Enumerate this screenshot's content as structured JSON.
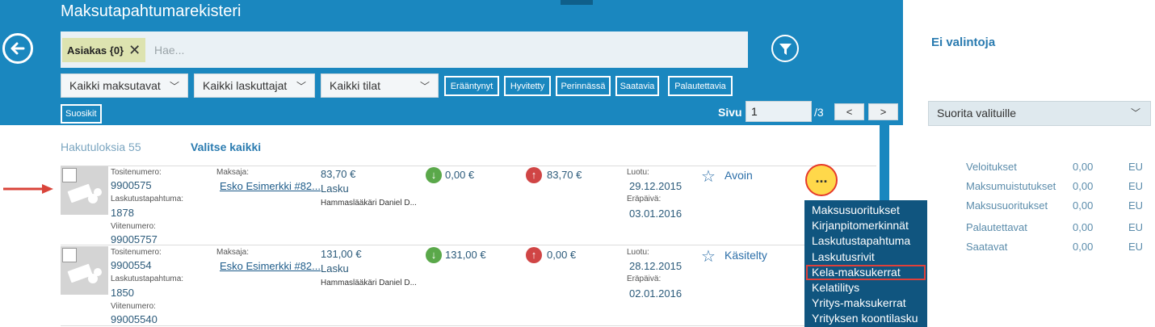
{
  "header": {
    "title": "Maksutapahtumarekisteri",
    "chip_label": "Asiakas {0}",
    "search_placeholder": "Hae...",
    "dropdowns": [
      "Kaikki maksutavat",
      "Kaikki laskuttajat",
      "Kaikki tilat"
    ],
    "filter_buttons": [
      "Erääntynyt",
      "Hyvitetty",
      "Perinnässä",
      "Saatavia",
      "Palautettavia"
    ],
    "favorites_label": "Suosikit",
    "page_label": "Sivu",
    "page_value": "1",
    "page_total": "/3",
    "prev_label": "<",
    "next_label": ">"
  },
  "results": {
    "count_label": "Hakutuloksia 55",
    "select_all_label": "Valitse kaikki",
    "rows": [
      {
        "tosite_label": "Tositenumero:",
        "tosite": "9900575",
        "laskutus_label": "Laskutustapahtuma:",
        "laskutus": "1878",
        "viite_label": "Viitenumero:",
        "viite": "99005757",
        "maksaja_label": "Maksaja:",
        "maksaja": "Esko Esimerkki #82...",
        "amount": "83,70 €",
        "type": "Lasku",
        "provider": "Hammaslääkäri Daniel D...",
        "paid": "0,00 €",
        "open": "83,70 €",
        "luotu_label": "Luotu:",
        "luotu": "29.12.2015",
        "erapaiva_label": "Eräpäivä:",
        "erapaiva": "03.01.2016",
        "status": "Avoin"
      },
      {
        "tosite_label": "Tositenumero:",
        "tosite": "9900554",
        "laskutus_label": "Laskutustapahtuma:",
        "laskutus": "1850",
        "viite_label": "Viitenumero:",
        "viite": "99005540",
        "maksaja_label": "Maksaja:",
        "maksaja": "Esko Esimerkki #82...",
        "amount": "131,00 €",
        "type": "Lasku",
        "provider": "Hammaslääkäri Daniel D...",
        "paid": "131,00 €",
        "open": "0,00 €",
        "luotu_label": "Luotu:",
        "luotu": "28.12.2015",
        "erapaiva_label": "Eräpäivä:",
        "erapaiva": "02.01.2016",
        "status": "Käsitelty"
      }
    ],
    "more_label": "..."
  },
  "menu": {
    "items": [
      "Maksusuoritukset",
      "Kirjanpitomerkinnät",
      "Laskutustapahtuma",
      "Laskutusrivit",
      "Kela-maksukerrat",
      "Kelatilitys",
      "Yritys-maksukerrat",
      "Yrityksen koontilasku"
    ],
    "highlighted": "Kela-maksukerrat"
  },
  "right_panel": {
    "title": "Ei valintoja",
    "action_select": "Suorita valituille",
    "summary": [
      {
        "label": "Veloitukset",
        "value": "0,00",
        "currency": "EU"
      },
      {
        "label": "Maksumuistutukset",
        "value": "0,00",
        "currency": "EU"
      },
      {
        "label": "Maksusuoritukset",
        "value": "0,00",
        "currency": "EU"
      },
      {
        "label": "Palautettavat",
        "value": "0,00",
        "currency": "EU"
      },
      {
        "label": "Saatavat",
        "value": "0,00",
        "currency": "EU"
      }
    ]
  },
  "colors": {
    "header_bg": "#1a87bf",
    "menu_bg": "#10557f",
    "highlight": "#e0403a",
    "more_button": "#ffd84a"
  }
}
